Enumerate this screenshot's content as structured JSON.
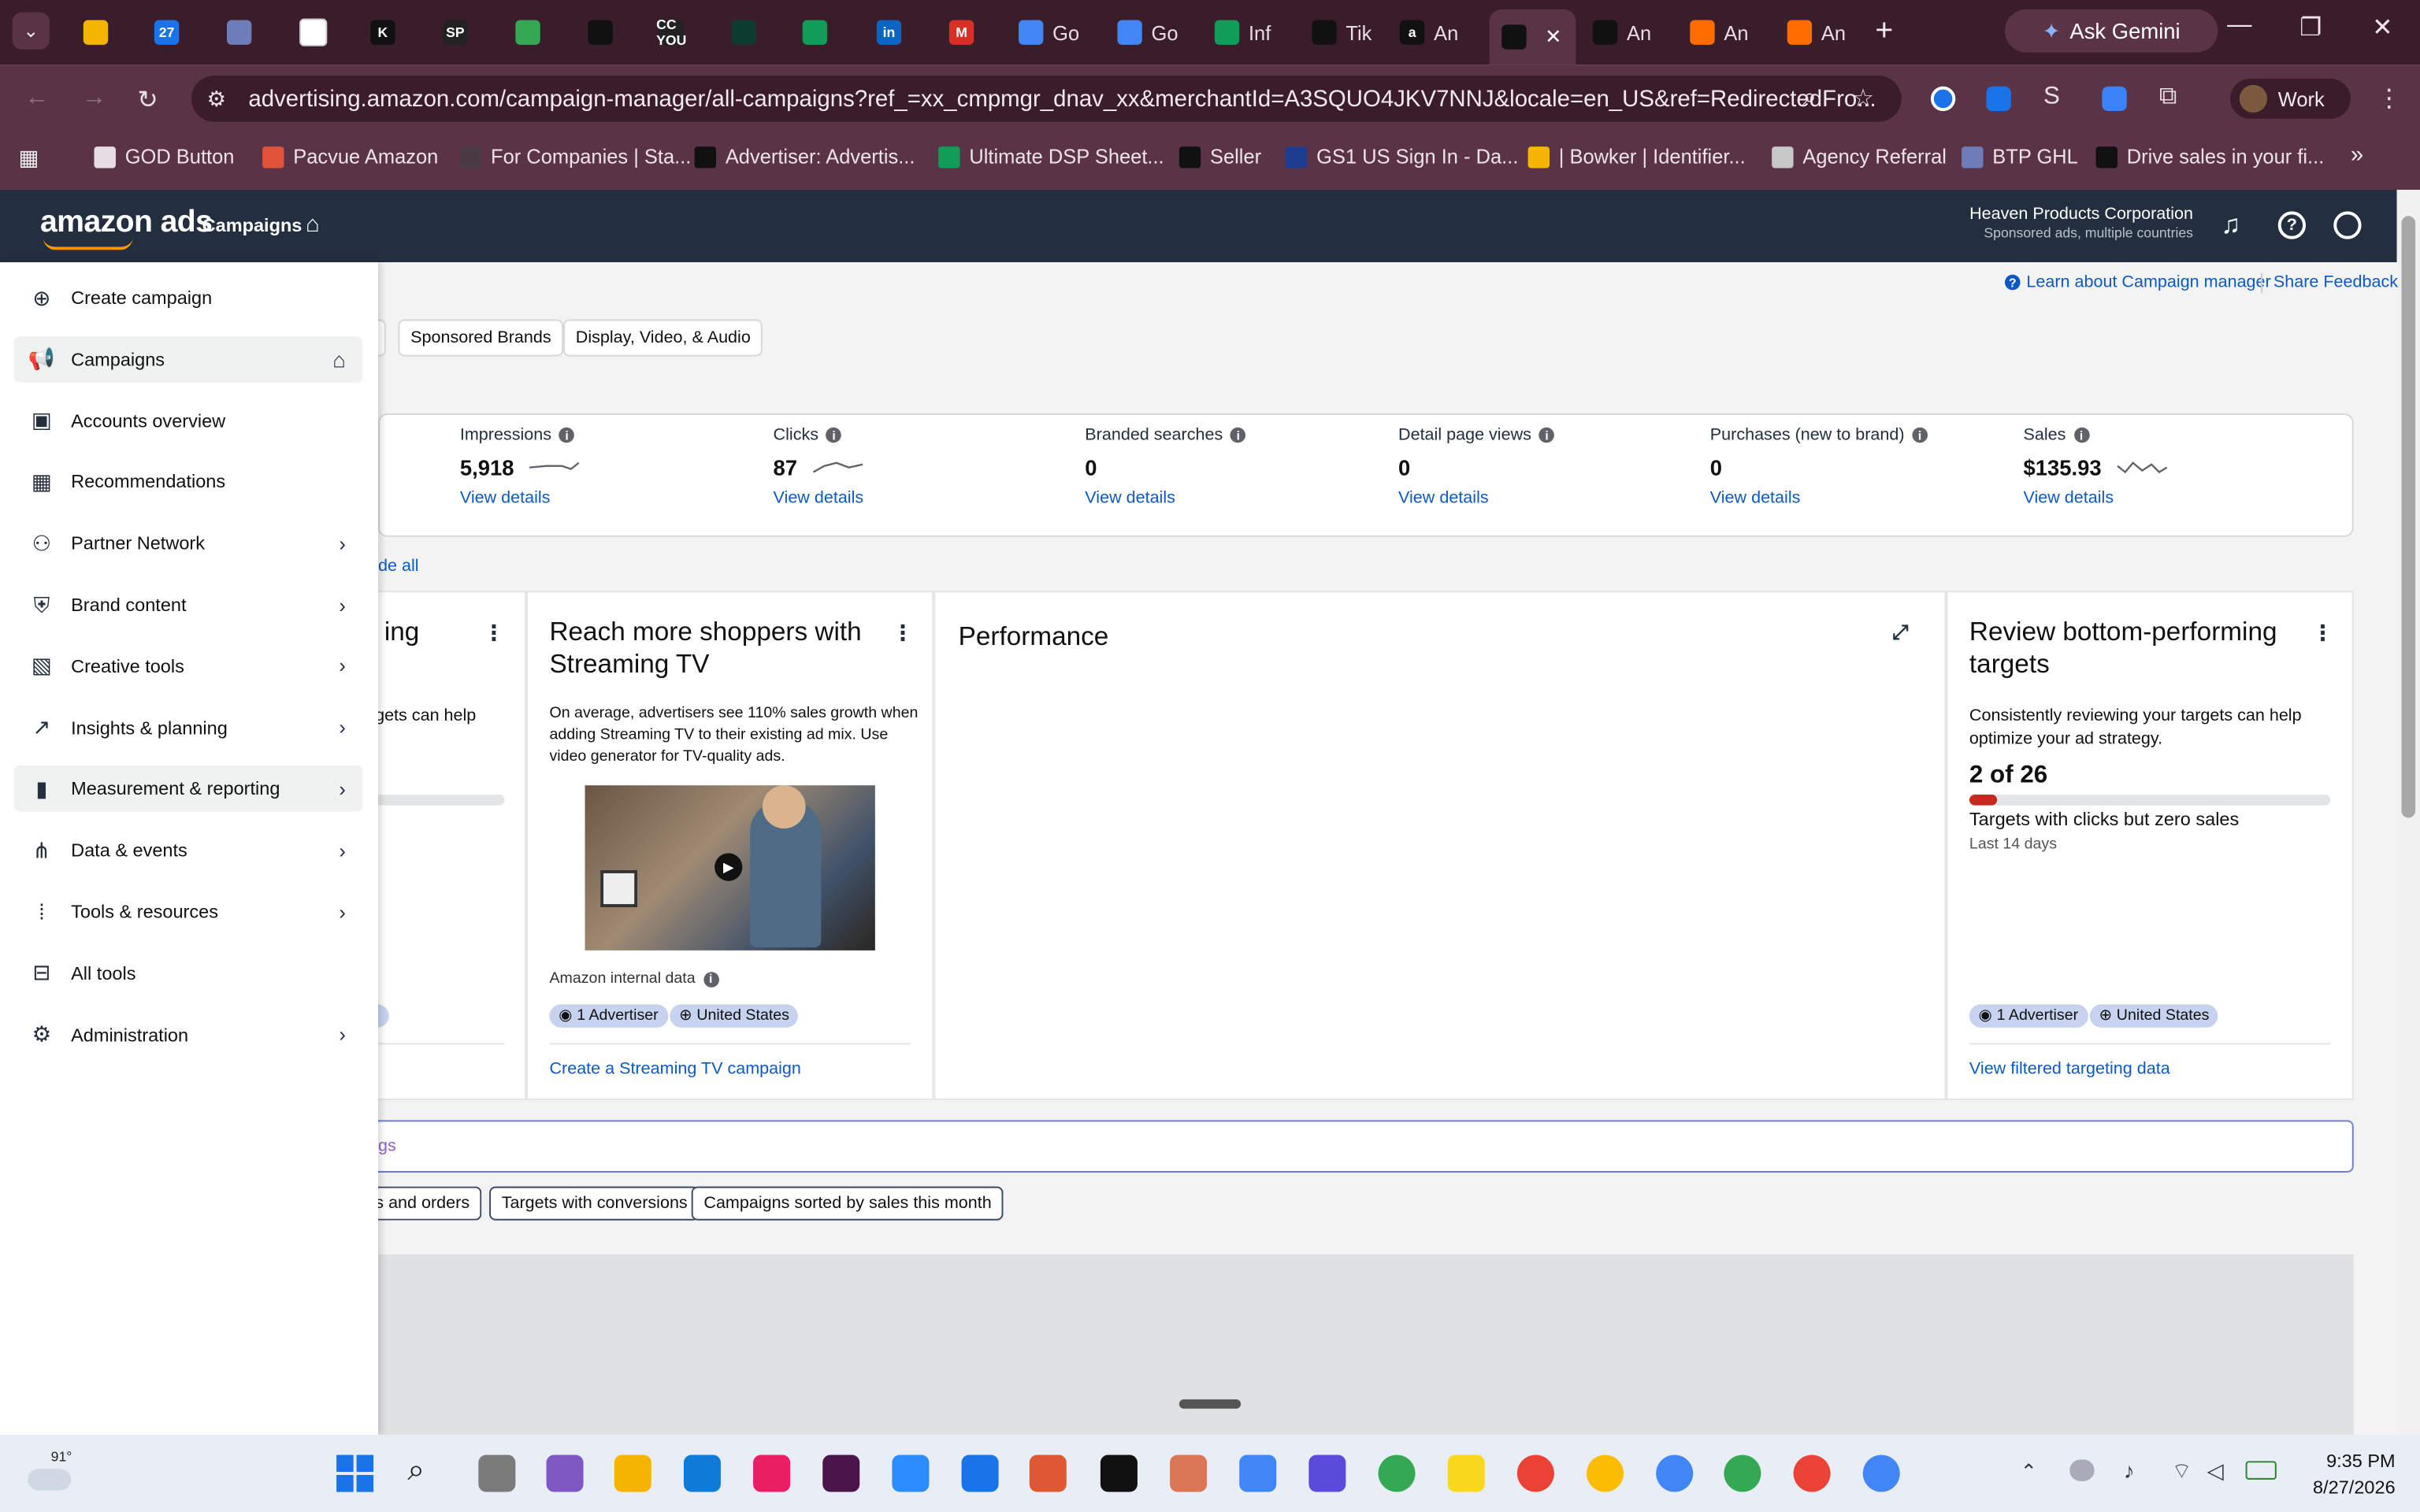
{
  "browser": {
    "tabs": [
      {
        "title": "",
        "color": "#f4b400",
        "icon": "lightbulb-icon"
      },
      {
        "title": "",
        "color": "#1a73e8",
        "icon": "calendar-icon",
        "glyph": "27"
      },
      {
        "title": "",
        "color": "#6f7cba",
        "icon": "diamond-icon"
      },
      {
        "title": "",
        "color": "#ffffff",
        "icon": "clickup-icon"
      },
      {
        "title": "",
        "color": "#111111",
        "icon": "k-icon",
        "glyph": "K"
      },
      {
        "title": "",
        "color": "#222222",
        "icon": "sp-icon",
        "glyph": "SP"
      },
      {
        "title": "",
        "color": "#34a853",
        "icon": "drive-icon"
      },
      {
        "title": "",
        "color": "#111111",
        "icon": "triangle-icon"
      },
      {
        "title": "",
        "color": "#222222",
        "icon": "ccyou-icon",
        "glyph": "CC YOU"
      },
      {
        "title": "",
        "color": "#0d3b2e",
        "icon": "arrow-icon"
      },
      {
        "title": "",
        "color": "#0f9d58",
        "icon": "sheets-icon"
      },
      {
        "title": "",
        "color": "#0a66c2",
        "icon": "linkedin-icon",
        "glyph": "in"
      },
      {
        "title": "",
        "color": "#d93025",
        "icon": "gmail-icon",
        "glyph": "M"
      },
      {
        "title": "Go",
        "color": "#4285f4",
        "icon": "docs-icon"
      },
      {
        "title": "Go",
        "color": "#4285f4",
        "icon": "docs-icon"
      },
      {
        "title": "Inf",
        "color": "#0f9d58",
        "icon": "sheets-icon"
      },
      {
        "title": "Tik",
        "color": "#111111",
        "icon": "tiktok-icon"
      },
      {
        "title": "An",
        "color": "#111111",
        "icon": "amazon-icon",
        "glyph": "a"
      },
      {
        "title": "",
        "color": "#111111",
        "icon": "amazon-smile-icon",
        "active": true
      },
      {
        "title": "An",
        "color": "#111111",
        "icon": "amazon-smile-icon"
      },
      {
        "title": "An",
        "color": "#ff6d00",
        "icon": "orange-icon"
      },
      {
        "title": "An",
        "color": "#ff6d00",
        "icon": "orange-icon"
      }
    ],
    "ask_gemini": "Ask Gemini",
    "url": "advertising.amazon.com/campaign-manager/all-campaigns?ref_=xx_cmpmgr_dnav_xx&merchantId=A3SQUO4JKV7NNJ&locale=en_US&ref=RedirectedFro...",
    "profile": "Work",
    "bookmarks": [
      {
        "label": "GOD Button",
        "color": "#e8dde3"
      },
      {
        "label": "Pacvue Amazon",
        "color": "#e2513a"
      },
      {
        "label": "For Companies | Sta...",
        "color": "#4a3a44"
      },
      {
        "label": "Advertiser: Advertis...",
        "color": "#111111"
      },
      {
        "label": "Ultimate DSP Sheet...",
        "color": "#0f9d58"
      },
      {
        "label": "Seller",
        "color": "#111111"
      },
      {
        "label": "GS1 US Sign In - Da...",
        "color": "#1d3c8f"
      },
      {
        "label": "| Bowker | Identifier...",
        "color": "#f4b400"
      },
      {
        "label": "Agency Referral",
        "color": "#c7c7c7"
      },
      {
        "label": "BTP GHL",
        "color": "#6f7cba"
      },
      {
        "label": "Drive sales in your fi...",
        "color": "#111111"
      }
    ]
  },
  "header": {
    "logo": "amazon ads",
    "nav_campaigns": "Campaigns",
    "account_name": "Heaven Products Corporation",
    "account_sub": "Sponsored ads, multiple countries"
  },
  "topbar": {
    "learn": "Learn about Campaign manager",
    "feedback": "Share Feedback"
  },
  "ad_type_tabs": [
    "Sponsored Brands",
    "Display, Video, & Audio"
  ],
  "metrics": [
    {
      "label": "Impressions",
      "value": "5,918",
      "link": "View details",
      "spark": true
    },
    {
      "label": "Clicks",
      "value": "87",
      "link": "View details",
      "spark": true
    },
    {
      "label": "Branded searches",
      "value": "0",
      "link": "View details",
      "spark": false
    },
    {
      "label": "Detail page views",
      "value": "0",
      "link": "View details",
      "spark": false
    },
    {
      "label": "Purchases (new to brand)",
      "value": "0",
      "link": "View details",
      "spark": false
    },
    {
      "label": "Sales",
      "value": "$135.93",
      "link": "View details",
      "spark": true
    }
  ],
  "hide_all": "de all",
  "cards": {
    "partial": {
      "title_fragment": "ing",
      "body_fragment": "gets can help"
    },
    "streaming": {
      "title": "Reach more shoppers with Streaming TV",
      "body": "On average, advertisers see 110% sales growth when adding Streaming TV to their existing ad mix. Use video generator for TV-quality ads.",
      "source": "Amazon internal data",
      "tags": [
        "1 Advertiser",
        "United States"
      ],
      "cta": "Create a Streaming TV campaign"
    },
    "performance": {
      "title": "Performance"
    },
    "review": {
      "title": "Review bottom-performing targets",
      "body": "Consistently reviewing your targets can help optimize your ad strategy.",
      "count": "2 of 26",
      "progress": 0.077,
      "subtitle": "Targets with clicks but zero sales",
      "period": "Last 14 days",
      "tags": [
        "1 Advertiser",
        "United States"
      ],
      "cta": "View filtered targeting data"
    }
  },
  "search_fragment": "gs",
  "quick_filters": [
    "ns and orders",
    "Targets with conversions",
    "Campaigns sorted by sales this month"
  ],
  "sidebar": {
    "items": [
      {
        "label": "Create campaign",
        "icon": "plus-circle-icon",
        "chevron": false
      },
      {
        "label": "Campaigns",
        "icon": "megaphone-icon",
        "chevron": false,
        "home": true,
        "active": true
      },
      {
        "label": "Accounts overview",
        "icon": "briefcase-icon",
        "chevron": false
      },
      {
        "label": "Recommendations",
        "icon": "grid-icon",
        "chevron": false
      },
      {
        "label": "Partner Network",
        "icon": "people-icon",
        "chevron": true
      },
      {
        "label": "Brand content",
        "icon": "shield-icon",
        "chevron": true
      },
      {
        "label": "Creative tools",
        "icon": "image-icon",
        "chevron": true
      },
      {
        "label": "Insights & planning",
        "icon": "trend-icon",
        "chevron": true
      },
      {
        "label": "Measurement & reporting",
        "icon": "bar-chart-icon",
        "chevron": true,
        "hover": true
      },
      {
        "label": "Data & events",
        "icon": "nodes-icon",
        "chevron": true
      },
      {
        "label": "Tools & resources",
        "icon": "dots-grid-icon",
        "chevron": true
      },
      {
        "label": "All tools",
        "icon": "toolbox-icon",
        "chevron": false
      },
      {
        "label": "Administration",
        "icon": "gear-icon",
        "chevron": true
      }
    ]
  },
  "taskbar": {
    "weather": "91°",
    "time": "9:35 PM",
    "date": "8/27/2026"
  }
}
